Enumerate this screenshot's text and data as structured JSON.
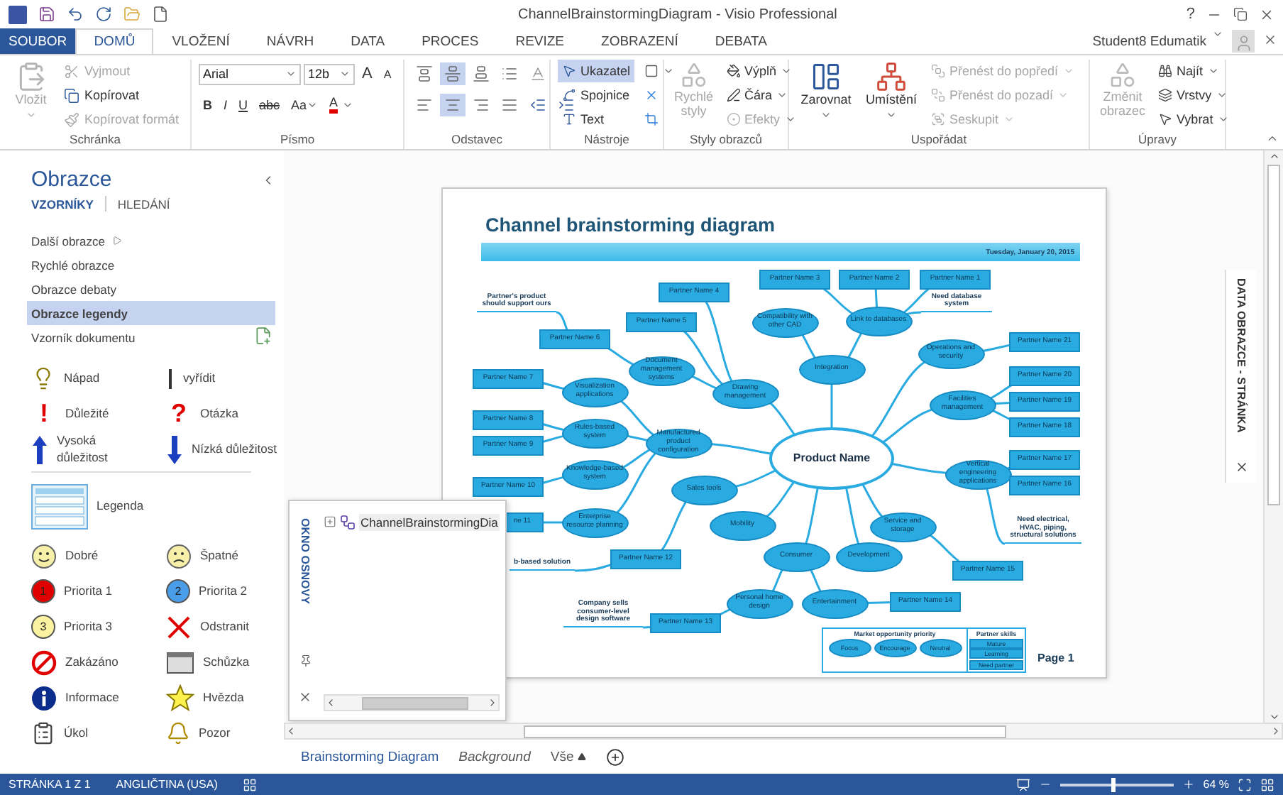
{
  "window": {
    "title": "ChannelBrainstormingDiagram - Visio Professional",
    "help": "?"
  },
  "tabs": [
    {
      "label": "SOUBOR",
      "kind": "file",
      "selected": false
    },
    {
      "label": "DOMŮ",
      "kind": "tab",
      "selected": true
    },
    {
      "label": "VLOŽENÍ",
      "kind": "tab",
      "selected": false
    },
    {
      "label": "NÁVRH",
      "kind": "tab",
      "selected": false
    },
    {
      "label": "DATA",
      "kind": "tab",
      "selected": false
    },
    {
      "label": "PROCES",
      "kind": "tab",
      "selected": false
    },
    {
      "label": "REVIZE",
      "kind": "tab",
      "selected": false
    },
    {
      "label": "ZOBRAZENÍ",
      "kind": "tab",
      "selected": false
    },
    {
      "label": "DEBATA",
      "kind": "tab",
      "selected": false
    }
  ],
  "user": {
    "name": "Student8 Edumatik"
  },
  "ribbon": {
    "clipboard": {
      "title": "Schránka",
      "paste": {
        "label": "Vložit",
        "disabled": true
      },
      "items": [
        {
          "label": "Vyjmout",
          "disabled": true
        },
        {
          "label": "Kopírovat",
          "disabled": false
        },
        {
          "label": "Kopírovat formát",
          "disabled": true
        }
      ]
    },
    "font": {
      "title": "Písmo",
      "family": "Arial",
      "size": "12b",
      "grow": "A",
      "shrink": "A",
      "formats": [
        "B",
        "I",
        "U",
        "abc",
        "Aa"
      ],
      "color_button": "A"
    },
    "paragraph": {
      "title": "Odstavec",
      "vertical": [
        {
          "selected": false
        },
        {
          "selected": true
        },
        {
          "selected": false
        }
      ],
      "horizontal": [
        {
          "selected": false
        },
        {
          "selected": true
        },
        {
          "selected": false
        },
        {
          "selected": false
        }
      ]
    },
    "tools": {
      "title": "Nástroje",
      "items": [
        {
          "label": "Ukazatel",
          "selected": true
        },
        {
          "label": "Spojnice",
          "selected": false
        },
        {
          "label": "Text",
          "selected": false
        }
      ]
    },
    "shape_styles": {
      "title": "Styly obrazců",
      "quick_styles": {
        "label": "Rychlé styly",
        "disabled": true
      },
      "items": [
        {
          "label": "Výplň",
          "disabled": false
        },
        {
          "label": "Čára",
          "disabled": false
        },
        {
          "label": "Efekty",
          "disabled": true
        }
      ]
    },
    "arrange": {
      "title": "Uspořádat",
      "align": "Zarovnat",
      "position": "Umístění",
      "items": [
        {
          "label": "Přenést do popředí",
          "disabled": true
        },
        {
          "label": "Přenést do pozadí",
          "disabled": true
        },
        {
          "label": "Seskupit",
          "disabled": true
        }
      ]
    },
    "editing": {
      "title": "Úpravy",
      "change_shape": {
        "label": "Změnit obrazec",
        "disabled": true
      },
      "items": [
        {
          "label": "Najít"
        },
        {
          "label": "Vrstvy"
        },
        {
          "label": "Vybrat"
        }
      ]
    }
  },
  "shapes_panel": {
    "title": "Obrazce",
    "tabs": [
      {
        "label": "VZORNÍKY",
        "selected": true
      },
      {
        "label": "HLEDÁNÍ",
        "selected": false
      }
    ],
    "stencils": [
      {
        "label": "Další obrazce",
        "kind": "more",
        "selected": false
      },
      {
        "label": "Rychlé obrazce",
        "kind": "stencil",
        "selected": false
      },
      {
        "label": "Obrazce debaty",
        "kind": "stencil",
        "selected": false
      },
      {
        "label": "Obrazce legendy",
        "kind": "stencil",
        "selected": true
      },
      {
        "label": "Vzorník dokumentu",
        "kind": "document",
        "selected": false
      }
    ],
    "items": [
      {
        "label": "Nápad",
        "kind": "idea"
      },
      {
        "label": "vyřídit",
        "kind": "todo"
      },
      {
        "label": "Důležité",
        "kind": "important",
        "glyph": "!"
      },
      {
        "label": "Otázka",
        "kind": "question",
        "glyph": "?"
      },
      {
        "label": "Vysoká důležitost",
        "kind": "high"
      },
      {
        "label": "Nízká důležitost",
        "kind": "low"
      },
      {
        "label": "Legenda",
        "kind": "legend"
      },
      {
        "label": "Dobré",
        "kind": "good"
      },
      {
        "label": "Špatné",
        "kind": "bad"
      },
      {
        "label": "Priorita 1",
        "kind": "priority",
        "badge": "1",
        "color": "#e00000"
      },
      {
        "label": "Priorita 2",
        "kind": "priority",
        "badge": "2",
        "color": "#4a9de8"
      },
      {
        "label": "Priorita 3",
        "kind": "priority",
        "badge": "3",
        "color": "#fbf3a0"
      },
      {
        "label": "Odstranit",
        "kind": "remove"
      },
      {
        "label": "Zakázáno",
        "kind": "forbidden"
      },
      {
        "label": "Schůzka",
        "kind": "meeting"
      },
      {
        "label": "Informace",
        "kind": "info"
      },
      {
        "label": "Hvězda",
        "kind": "star"
      },
      {
        "label": "Úkol",
        "kind": "task"
      },
      {
        "label": "Pozor",
        "kind": "warning"
      }
    ]
  },
  "diagram": {
    "title": "Channel brainstorming diagram",
    "date": "Tuesday, January 20, 2015",
    "page_label": "Page 1",
    "nodes": [
      {
        "kind": "partner",
        "label": "Partner Name 3"
      },
      {
        "kind": "partner",
        "label": "Partner Name 2"
      },
      {
        "kind": "partner",
        "label": "Partner Name 1"
      },
      {
        "kind": "note",
        "label": "Partner's product should support ours"
      },
      {
        "kind": "partner",
        "label": "Partner Name 4"
      },
      {
        "kind": "note",
        "label": "Need database system"
      },
      {
        "kind": "partner",
        "label": "Partner Name 6"
      },
      {
        "kind": "partner",
        "label": "Partner Name 5"
      },
      {
        "kind": "topic",
        "label": "Compatibility with other CAD"
      },
      {
        "kind": "topic",
        "label": "Link to databases"
      },
      {
        "kind": "topic",
        "label": "Operations and security"
      },
      {
        "kind": "partner",
        "label": "Partner Name 21"
      },
      {
        "kind": "partner",
        "label": "Partner Name 7"
      },
      {
        "kind": "topic",
        "label": "Document management systems"
      },
      {
        "kind": "topic",
        "label": "Integration"
      },
      {
        "kind": "partner",
        "label": "Partner Name 20"
      },
      {
        "kind": "topic",
        "label": "Visualization applications"
      },
      {
        "kind": "topic",
        "label": "Drawing management"
      },
      {
        "kind": "topic",
        "label": "Facilities management"
      },
      {
        "kind": "partner",
        "label": "Partner Name 19"
      },
      {
        "kind": "partner",
        "label": "Partner Name 8"
      },
      {
        "kind": "partner",
        "label": "Partner Name 9"
      },
      {
        "kind": "topic",
        "label": "Rules-based system"
      },
      {
        "kind": "topic",
        "label": "Manufactured product configuration"
      },
      {
        "kind": "center",
        "label": "Product Name"
      },
      {
        "kind": "partner",
        "label": "Partner Name 18"
      },
      {
        "kind": "partner",
        "label": "Partner Name 17"
      },
      {
        "kind": "partner",
        "label": "Partner Name 10"
      },
      {
        "kind": "topic",
        "label": "Knowledge-based system"
      },
      {
        "kind": "topic",
        "label": "Sales tools"
      },
      {
        "kind": "topic",
        "label": "Vertical engineering applications"
      },
      {
        "kind": "partner",
        "label": "Partner Name 16"
      },
      {
        "kind": "partner",
        "label": "ne 11"
      },
      {
        "kind": "topic",
        "label": "Enterprise resource planning"
      },
      {
        "kind": "topic",
        "label": "Mobility"
      },
      {
        "kind": "topic",
        "label": "Service and storage"
      },
      {
        "kind": "note",
        "label": "Need electrical, HVAC, piping, structural solutions"
      },
      {
        "kind": "note",
        "label": "b-based solution"
      },
      {
        "kind": "partner",
        "label": "Partner Name 12"
      },
      {
        "kind": "topic",
        "label": "Consumer"
      },
      {
        "kind": "topic",
        "label": "Development"
      },
      {
        "kind": "partner",
        "label": "Partner Name 15"
      },
      {
        "kind": "note",
        "label": "Company sells consumer-level design software"
      },
      {
        "kind": "partner",
        "label": "Partner Name 13"
      },
      {
        "kind": "topic",
        "label": "Personal home design"
      },
      {
        "kind": "topic",
        "label": "Entertainment"
      },
      {
        "kind": "partner",
        "label": "Partner Name 14"
      }
    ],
    "legend": {
      "priority_title": "Market opportunity priority",
      "priorities": [
        "Focus",
        "Encourage",
        "Neutral"
      ],
      "skills_title": "Partner skills",
      "skills": [
        "Mature",
        "Learning",
        "Need partner"
      ]
    }
  },
  "outline": {
    "title": "OKNO OSNOVY",
    "tree": [
      {
        "label": "ChannelBrainstormingDia",
        "expanded": false
      }
    ]
  },
  "shape_data": {
    "title": "DATA OBRAZCE - STRÁNKA"
  },
  "pages": [
    {
      "label": "Brainstorming Diagram",
      "kind": "foreground",
      "selected": true
    },
    {
      "label": "Background",
      "kind": "background",
      "selected": false
    }
  ],
  "all_pages": "Vše",
  "status_bar": {
    "page": "STRÁNKA 1 Z 1",
    "language": "ANGLIČTINA (USA)",
    "zoom": "64 %",
    "level": 0.45
  }
}
